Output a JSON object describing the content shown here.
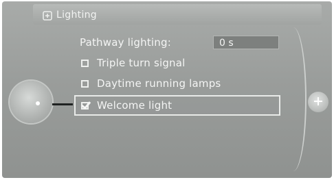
{
  "header": {
    "title": "Lighting"
  },
  "settings": {
    "pathway_label": "Pathway lighting:",
    "pathway_value": "0 s",
    "items": [
      {
        "label": "Triple turn signal",
        "checked": false
      },
      {
        "label": "Daytime running lamps",
        "checked": false
      },
      {
        "label": "Welcome light",
        "checked": true
      }
    ]
  },
  "icons": {
    "title_icon": "light-bulb-icon",
    "controller_left": "controller-knob-icon",
    "controller_right": "plus-icon"
  },
  "colors": {
    "background": "#9a9d9b",
    "text": "#f4f5f4",
    "selection_border": "#e9ebe9"
  }
}
